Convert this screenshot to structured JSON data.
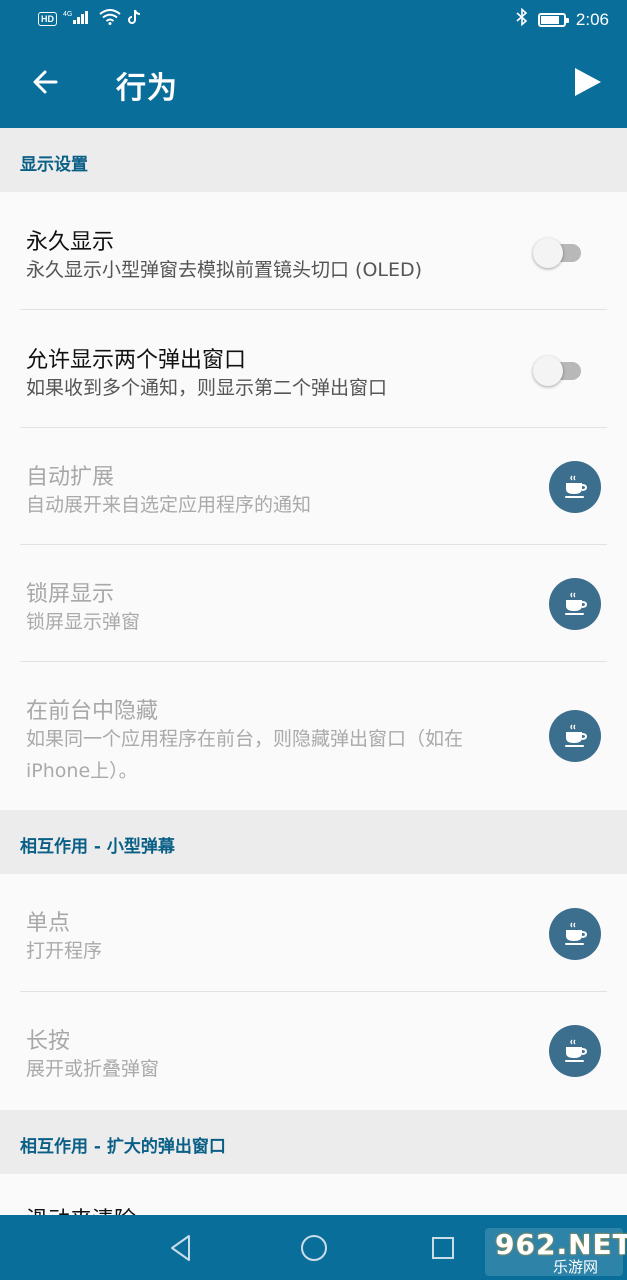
{
  "statusbar": {
    "hd": "HD",
    "signal": "4G",
    "time": "2:06",
    "battery_level": 0.8
  },
  "appbar": {
    "title": "行为",
    "back_icon": "arrow-left-icon",
    "play_icon": "play-icon"
  },
  "sections": [
    {
      "header": "显示设置"
    },
    {
      "header": "相互作用 - 小型弹幕"
    },
    {
      "header": "相互作用 - 扩大的弹出窗口"
    }
  ],
  "rows": [
    {
      "title": "永久显示",
      "subtitle": "永久显示小型弹窗去模拟前置镜头切口 (OLED)",
      "control": "toggle",
      "enabled": false
    },
    {
      "title": "允许显示两个弹出窗口",
      "subtitle": "如果收到多个通知，则显示第二个弹出窗口",
      "control": "toggle",
      "enabled": false
    },
    {
      "title": "自动扩展",
      "subtitle": "自动展开来自选定应用程序的通知",
      "control": "premium"
    },
    {
      "title": "锁屏显示",
      "subtitle": "锁屏显示弹窗",
      "control": "premium"
    },
    {
      "title": "在前台中隐藏",
      "subtitle": "如果同一个应用程序在前台，则隐藏弹出窗口（如在iPhone上）。",
      "control": "premium"
    },
    {
      "title": "单点",
      "subtitle": "打开程序",
      "control": "premium"
    },
    {
      "title": "长按",
      "subtitle": "展开或折叠弹窗",
      "control": "premium"
    },
    {
      "title": "滑动来清除"
    }
  ],
  "watermark": {
    "brand": "962.NET",
    "caption": "乐游网"
  },
  "colors": {
    "primary": "#0a6e9b",
    "section_text": "#0a5f86",
    "premium_badge": "#3c6e8e"
  }
}
